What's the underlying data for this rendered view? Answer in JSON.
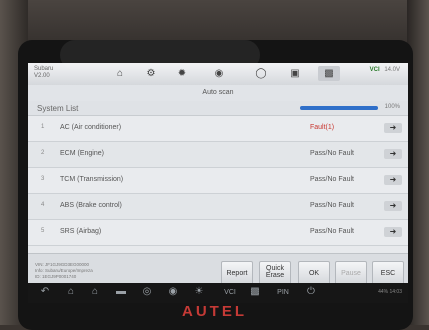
{
  "vehicle": {
    "make": "Subaru",
    "model": "V2.00"
  },
  "nav_icons": [
    "home-icon",
    "tools-icon",
    "settings-icon",
    "camera-icon",
    "record-icon",
    "save-icon",
    "message-icon"
  ],
  "status": {
    "vci": "VCI",
    "battery": "14.0V"
  },
  "page": {
    "title": "Auto scan"
  },
  "section": {
    "label": "System List",
    "progress_percent": 100,
    "progress_text": "100%"
  },
  "systems": [
    {
      "num": "1",
      "name": "AC (Air conditioner)",
      "status": "Fault(1)",
      "fault": true
    },
    {
      "num": "2",
      "name": "ECM (Engine)",
      "status": "Pass/No Fault",
      "fault": false
    },
    {
      "num": "3",
      "name": "TCM (Transmission)",
      "status": "Pass/No Fault",
      "fault": false
    },
    {
      "num": "4",
      "name": "ABS (Brake control)",
      "status": "Pass/No Fault",
      "fault": false
    },
    {
      "num": "5",
      "name": "SRS (Airbag)",
      "status": "Pass/No Fault",
      "fault": false
    }
  ],
  "vin_info": {
    "line1": "VIN: JF1GJ9GD3EG00000",
    "line2": "Info: Subaru/Europe/Impreza",
    "line3": "ID: 1EGJ9P0001740"
  },
  "buttons": {
    "report": "Report",
    "quick_erase_line1": "Quick",
    "quick_erase_line2": "Erase",
    "ok": "OK",
    "pause": "Pause",
    "esc": "ESC"
  },
  "android_status": "44% 14:03",
  "brand": "AUTEL"
}
